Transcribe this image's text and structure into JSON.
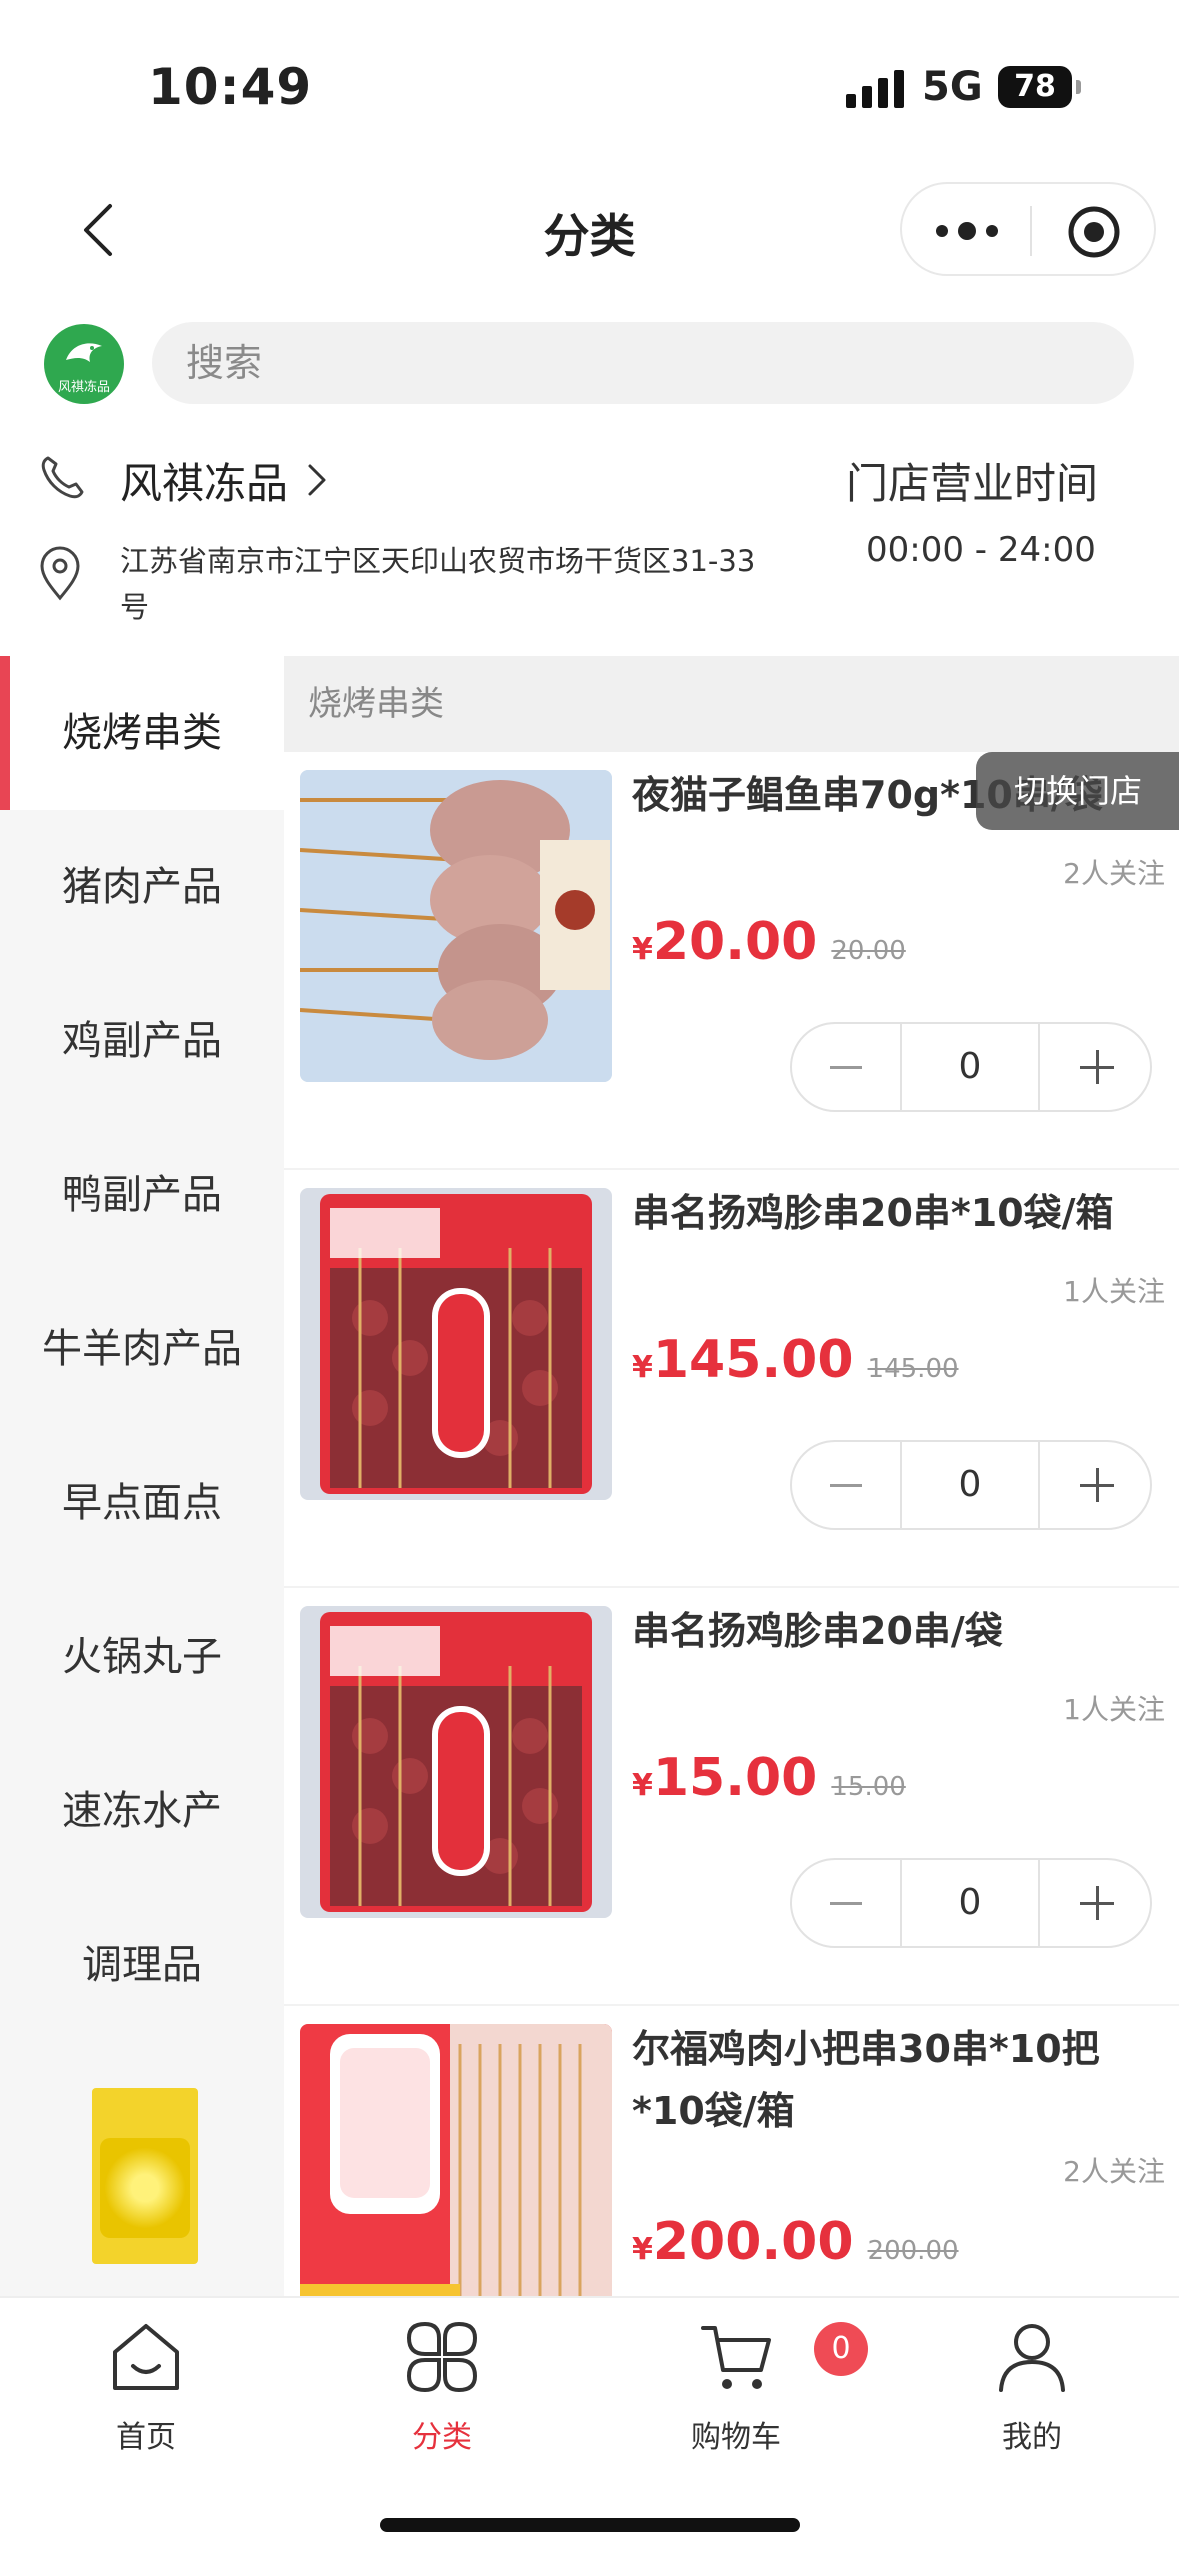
{
  "status": {
    "time": "10:49",
    "network": "5G",
    "battery": "78"
  },
  "nav": {
    "title": "分类"
  },
  "shop": {
    "logo_text": "风祺冻品"
  },
  "search": {
    "placeholder": "搜索"
  },
  "store": {
    "name": "风祺冻品",
    "hours_label": "门店营业时间",
    "hours": "00:00 - 24:00",
    "address": "江苏省南京市江宁区天印山农贸市场干货区31-33号"
  },
  "sidebar": {
    "items": [
      {
        "label": "烧烤串类",
        "active": true
      },
      {
        "label": "猪肉产品"
      },
      {
        "label": "鸡副产品"
      },
      {
        "label": "鸭副产品"
      },
      {
        "label": "牛羊肉产品"
      },
      {
        "label": "早点面点"
      },
      {
        "label": "火锅丸子"
      },
      {
        "label": "速冻水产"
      },
      {
        "label": "调理品"
      }
    ]
  },
  "content": {
    "category_title": "烧烤串类",
    "switch_store": "切换门店",
    "products": [
      {
        "name": "夜猫子鲳鱼串70g*10串/袋",
        "follow": "2人关注",
        "currency": "¥",
        "price": "20.00",
        "original_price": "20.00",
        "quantity": "0"
      },
      {
        "name": "串名扬鸡胗串20串*10袋/箱",
        "follow": "1人关注",
        "currency": "¥",
        "price": "145.00",
        "original_price": "145.00",
        "quantity": "0"
      },
      {
        "name": "串名扬鸡胗串20串/袋",
        "follow": "1人关注",
        "currency": "¥",
        "price": "15.00",
        "original_price": "15.00",
        "quantity": "0"
      },
      {
        "name": "尔福鸡肉小把串30串*10把\n*10袋/箱",
        "follow": "2人关注",
        "currency": "¥",
        "price": "200.00",
        "original_price": "200.00",
        "quantity": "0"
      }
    ]
  },
  "tabbar": {
    "items": [
      {
        "label": "首页",
        "icon": "home-icon"
      },
      {
        "label": "分类",
        "icon": "category-icon",
        "active": true
      },
      {
        "label": "购物车",
        "icon": "cart-icon",
        "badge": "0"
      },
      {
        "label": "我的",
        "icon": "user-icon"
      }
    ]
  },
  "colors": {
    "accent": "#e6313d",
    "badge": "#ef4b55",
    "brand_green": "#2fa84f"
  }
}
